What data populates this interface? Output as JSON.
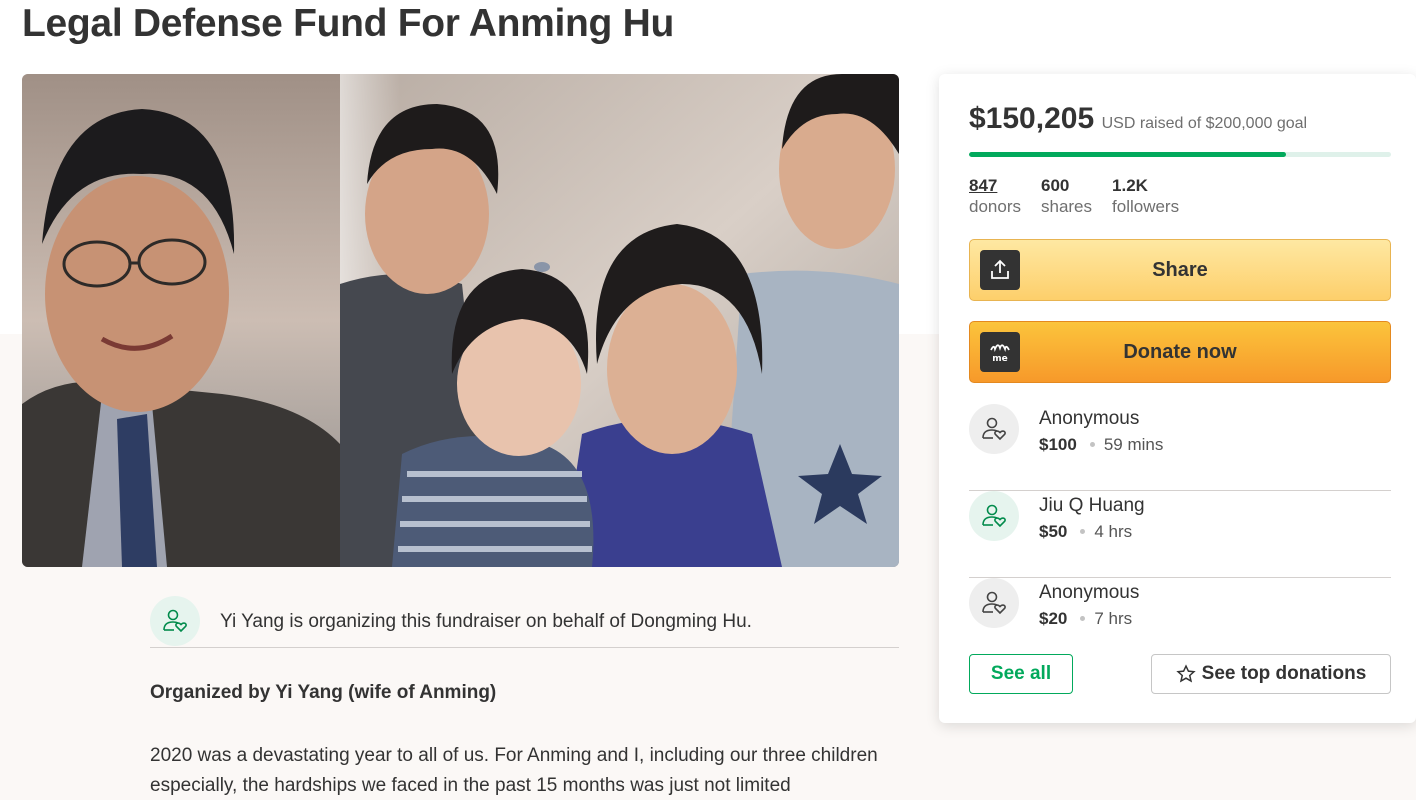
{
  "campaign": {
    "title": "Legal Defense Fund For Anming Hu"
  },
  "hero": {
    "alt": "Photo of Anming Hu and his family"
  },
  "organizer": {
    "icon": "user-heart-icon",
    "text": "Yi Yang is organizing this fundraiser on behalf of Dongming Hu.",
    "organized_by": "Organized by Yi Yang (wife of Anming)"
  },
  "story": {
    "text": "2020 was a devastating year to all of us. For Anming and I, including our three children especially, the hardships we faced in the past 15 months was just not limited"
  },
  "funding": {
    "amount": "$150,205",
    "goal_text": "USD raised of $200,000 goal",
    "progress_fraction": 0.751
  },
  "stats": [
    {
      "value": "847",
      "label": "donors"
    },
    {
      "value": "600",
      "label": "shares"
    },
    {
      "value": "1.2K",
      "label": "followers"
    }
  ],
  "actions": {
    "share_label": "Share",
    "share_icon": "upload-share-icon",
    "donate_label": "Donate now",
    "donate_icon": "gofundme-logo-icon"
  },
  "donations": [
    {
      "name": "Anonymous",
      "amount": "$100",
      "time": "59 mins"
    },
    {
      "name": "Jiu Q Huang",
      "amount": "$50",
      "time": "4 hrs"
    },
    {
      "name": "Anonymous",
      "amount": "$20",
      "time": "7 hrs"
    }
  ],
  "buttons": {
    "see_all": "See all",
    "see_top": "See top donations"
  },
  "colors": {
    "brand_green": "#02a95c",
    "share_yellow": "#fdd87f",
    "donate_orange": "#f9ae33"
  }
}
